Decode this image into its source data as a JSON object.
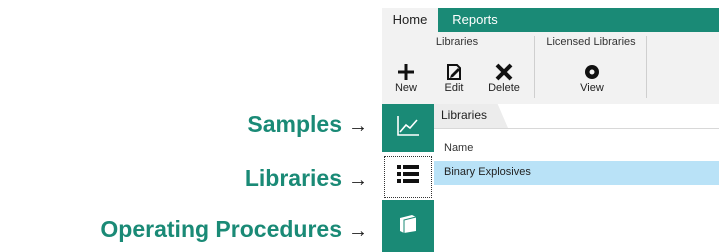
{
  "callouts": {
    "samples": "Samples",
    "libraries": "Libraries",
    "operating_procedures": "Operating Procedures",
    "arrow": "→"
  },
  "ribbon": {
    "tabs": [
      {
        "label": "Home",
        "active": true
      },
      {
        "label": "Reports",
        "active": false
      }
    ],
    "groups": {
      "libraries": {
        "title": "Libraries",
        "buttons": [
          {
            "label": "New",
            "icon": "plus-icon"
          },
          {
            "label": "Edit",
            "icon": "edit-icon"
          },
          {
            "label": "Delete",
            "icon": "delete-x-icon"
          }
        ]
      },
      "licensed": {
        "title": "Licensed Libraries",
        "buttons": [
          {
            "label": "View",
            "icon": "view-icon"
          }
        ]
      }
    }
  },
  "rail": {
    "items": [
      {
        "name": "samples",
        "icon": "chart-line-icon",
        "selected": true
      },
      {
        "name": "libraries",
        "icon": "list-icon",
        "selected": false
      },
      {
        "name": "operating-procedures",
        "icon": "book-icon",
        "selected": true
      }
    ]
  },
  "content": {
    "breadcrumb": "Libraries",
    "column_header": "Name",
    "rows": [
      "Binary Explosives"
    ]
  },
  "colors": {
    "accent": "#1a8a76",
    "selection": "#b9e2f7",
    "ribbon_bg": "#f2f2f2"
  }
}
